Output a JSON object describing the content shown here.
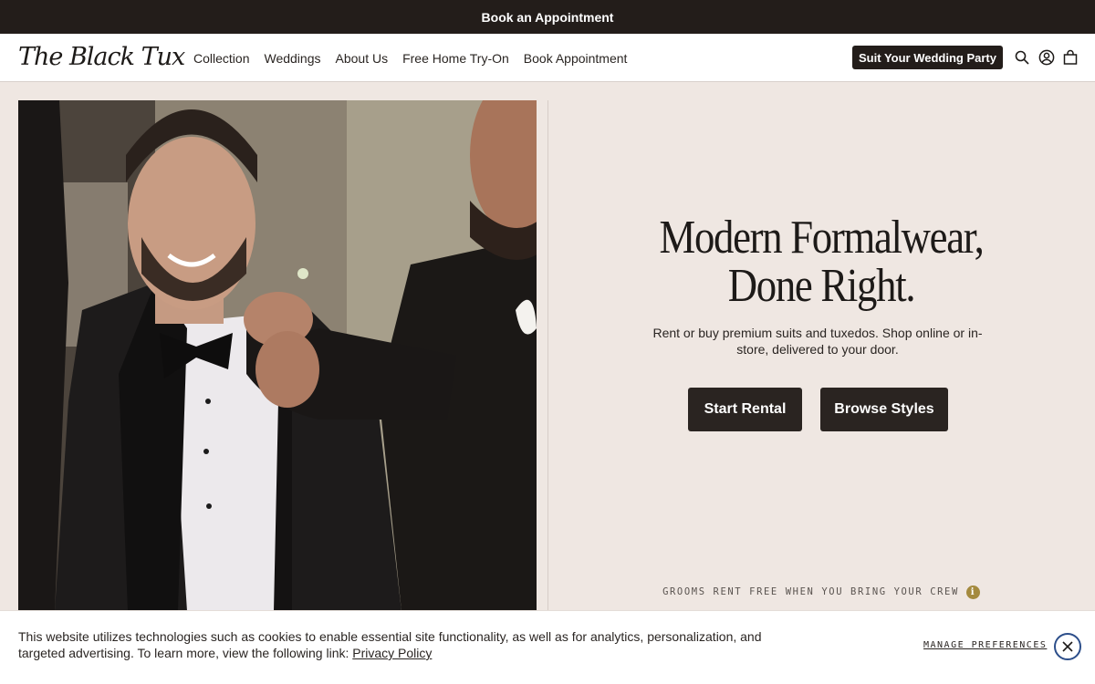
{
  "promo_bar": {
    "label": "Book an Appointment"
  },
  "header": {
    "logo_text": "The Black Tux",
    "nav": [
      "Collection",
      "Weddings",
      "About Us",
      "Free Home Try-On",
      "Book Appointment"
    ],
    "cta": "Suit Your Wedding Party",
    "icons": [
      "search-icon",
      "account-icon",
      "cart-icon"
    ]
  },
  "hero": {
    "image_alt": "Groom in black tuxedo adjusting bow tie with groomsman",
    "title_line1": "Modern Formalwear,",
    "title_line2": "Done Right.",
    "subtitle": "Rent or buy premium suits and tuxedos. Shop online or in-store, delivered to your door.",
    "primary_button": "Start Rental",
    "secondary_button": "Browse Styles",
    "note": "GROOMS RENT FREE WHEN YOU BRING YOUR CREW",
    "note_icon": "i"
  },
  "cookie_banner": {
    "text": "This website utilizes technologies such as cookies to enable essential site functionality, as well as for analytics, personalization, and targeted advertising. To learn more, view the following link:",
    "link": "Privacy Policy",
    "manage": "MANAGE PREFERENCES"
  },
  "colors": {
    "page_bg": "#efe7e2",
    "dark": "#231d1a",
    "accent_gold": "#a48a3e",
    "close_ring": "#2c4e8a"
  }
}
